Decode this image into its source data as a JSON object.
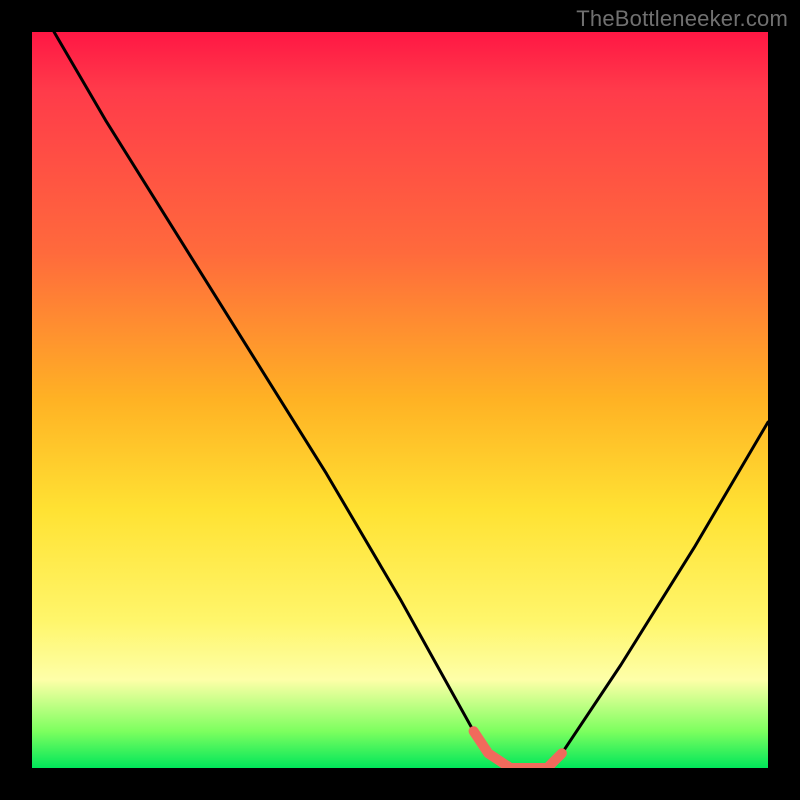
{
  "watermark": "TheBottleneeker.com",
  "chart_data": {
    "type": "line",
    "title": "",
    "xlabel": "",
    "ylabel": "",
    "xlim": [
      0,
      100
    ],
    "ylim": [
      0,
      100
    ],
    "series": [
      {
        "name": "curve",
        "x": [
          3,
          10,
          20,
          30,
          40,
          50,
          55,
          60,
          62,
          65,
          70,
          72,
          80,
          90,
          100
        ],
        "values": [
          100,
          88,
          72,
          56,
          40,
          23,
          14,
          5,
          2,
          0,
          0,
          2,
          14,
          30,
          47
        ]
      },
      {
        "name": "highlight-segment",
        "x": [
          60,
          62,
          65,
          70,
          72
        ],
        "values": [
          5,
          2,
          0,
          0,
          2
        ]
      }
    ],
    "colors": {
      "curve": "#000000",
      "highlight": "#f16a5c",
      "gradient_stops": [
        "#ff1744",
        "#ff6a3c",
        "#ffb224",
        "#ffe233",
        "#fff66b",
        "#00e65a"
      ]
    }
  }
}
